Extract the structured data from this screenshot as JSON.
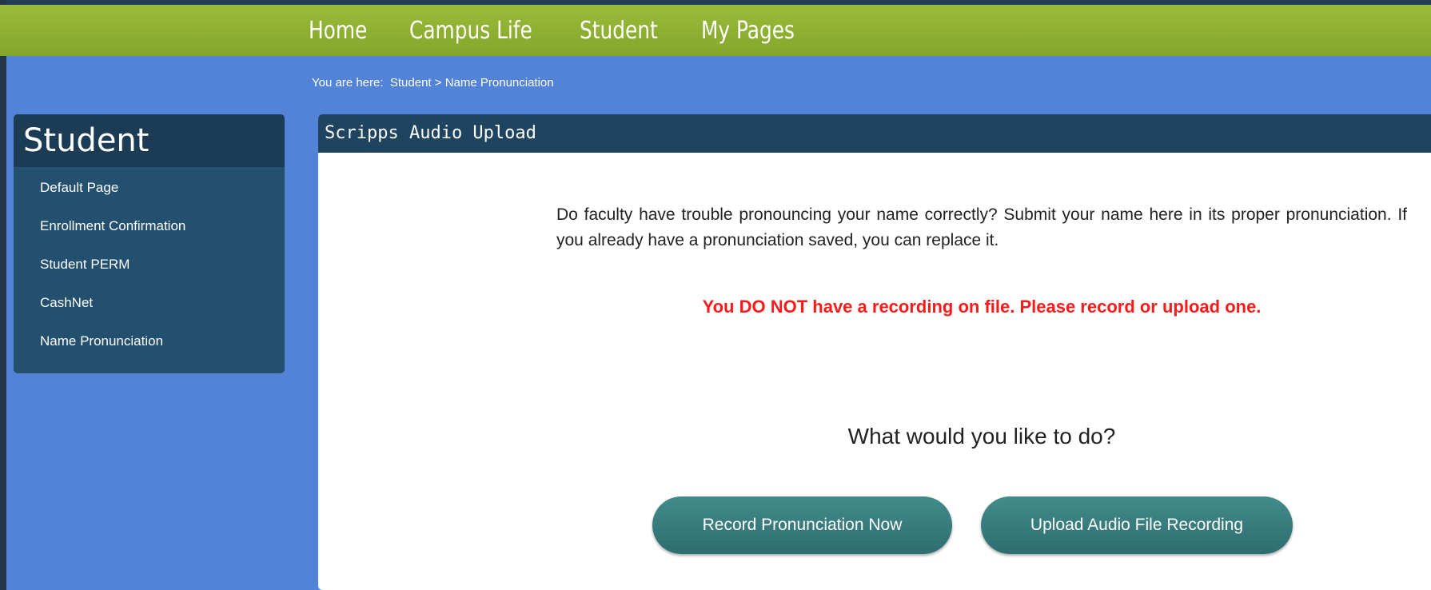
{
  "nav": {
    "items": [
      {
        "label": "Home"
      },
      {
        "label": "Campus Life"
      },
      {
        "label": "Student"
      },
      {
        "label": "My Pages"
      }
    ]
  },
  "breadcrumb": {
    "prefix": "You are here:",
    "items": [
      "Student",
      "Name Pronunciation"
    ],
    "separator": ">"
  },
  "sidebar": {
    "title": "Student",
    "items": [
      {
        "label": "Default Page"
      },
      {
        "label": "Enrollment Confirmation"
      },
      {
        "label": "Student PERM"
      },
      {
        "label": "CashNet"
      },
      {
        "label": "Name Pronunciation"
      }
    ]
  },
  "panel": {
    "title": "Scripps Audio Upload",
    "intro": "Do faculty have trouble pronouncing your name correctly? Submit your name here in its proper pronunciation. If you already have a pronunciation saved, you can replace it.",
    "warning": "You DO NOT have a recording on file. Please record or upload one.",
    "question": "What would you like to do?",
    "record_button": "Record Pronunciation Now",
    "upload_button": "Upload Audio File Recording"
  },
  "colors": {
    "nav_green": "#8fb232",
    "page_blue": "#5383d6",
    "sidebar_navy": "#23506e",
    "panel_header": "#1f4460",
    "warning_red": "#ff1a1a",
    "button_teal": "#3a7e80"
  }
}
